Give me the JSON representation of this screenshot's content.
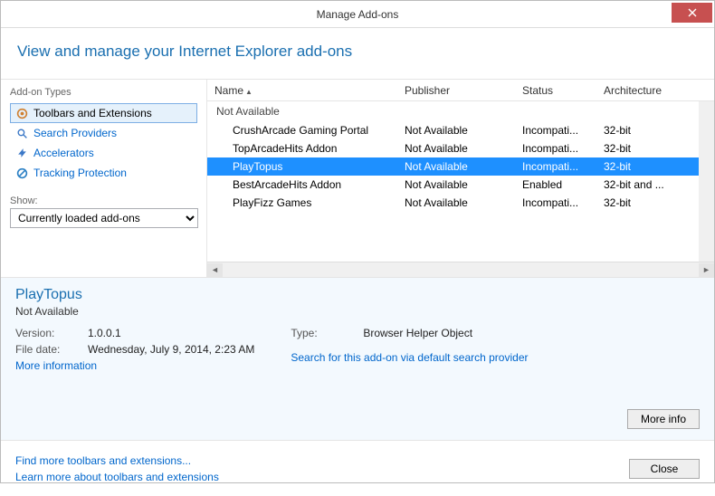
{
  "window": {
    "title": "Manage Add-ons"
  },
  "header": {
    "text": "View and manage your Internet Explorer add-ons"
  },
  "sidebar": {
    "title": "Add-on Types",
    "items": [
      {
        "label": "Toolbars and Extensions",
        "selected": true
      },
      {
        "label": "Search Providers"
      },
      {
        "label": "Accelerators"
      },
      {
        "label": "Tracking Protection"
      }
    ],
    "show_label": "Show:",
    "show_value": "Currently loaded add-ons"
  },
  "table": {
    "columns": {
      "name": "Name",
      "publisher": "Publisher",
      "status": "Status",
      "arch": "Architecture"
    },
    "group": "Not Available",
    "rows": [
      {
        "name": "CrushArcade Gaming Portal",
        "publisher": "Not Available",
        "status": "Incompati...",
        "arch": "32-bit"
      },
      {
        "name": "TopArcadeHits Addon",
        "publisher": "Not Available",
        "status": "Incompati...",
        "arch": "32-bit"
      },
      {
        "name": "PlayTopus",
        "publisher": "Not Available",
        "status": "Incompati...",
        "arch": "32-bit",
        "selected": true
      },
      {
        "name": "BestArcadeHits Addon",
        "publisher": "Not Available",
        "status": "Enabled",
        "arch": "32-bit and ..."
      },
      {
        "name": "PlayFizz Games",
        "publisher": "Not Available",
        "status": "Incompati...",
        "arch": "32-bit"
      }
    ]
  },
  "details": {
    "title": "PlayTopus",
    "subtitle": "Not Available",
    "version_label": "Version:",
    "version": "1.0.0.1",
    "filedate_label": "File date:",
    "filedate": "Wednesday, July 9, 2014, 2:23 AM",
    "more_info": "More information",
    "type_label": "Type:",
    "type": "Browser Helper Object",
    "search_link": "Search for this add-on via default search provider",
    "more_info_btn": "More info"
  },
  "footer": {
    "link1": "Find more toolbars and extensions...",
    "link2": "Learn more about toolbars and extensions",
    "close": "Close"
  }
}
